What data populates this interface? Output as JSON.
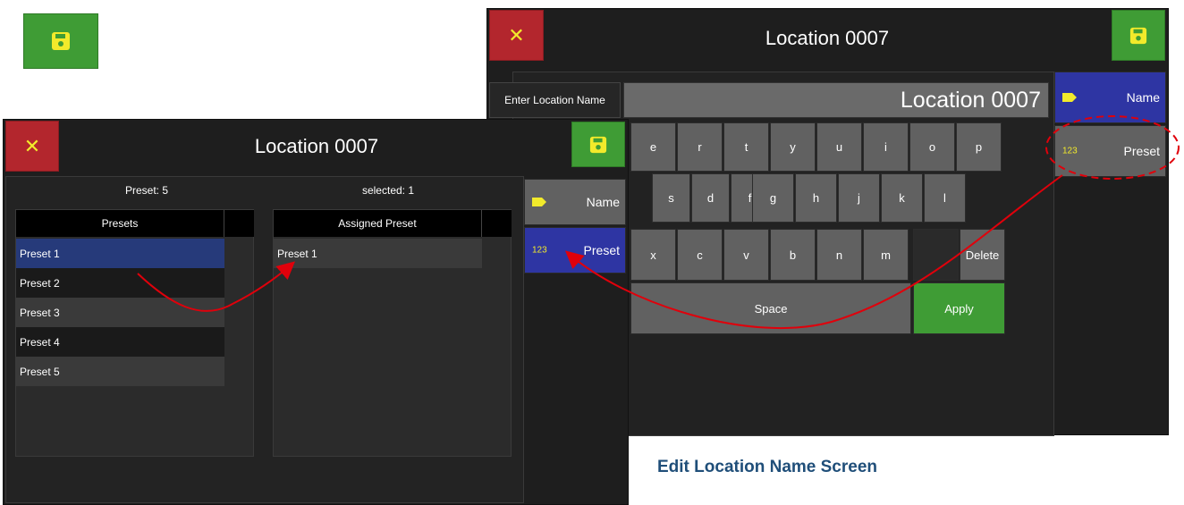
{
  "floating_save": {
    "icon": "save-icon"
  },
  "main_screen": {
    "title": "Location 0007",
    "preset_count_label": "Preset: 5",
    "selected_label": "selected: 1",
    "presets_header": "Presets",
    "assigned_header": "Assigned Preset",
    "presets": [
      "Preset 1",
      "Preset 2",
      "Preset 3",
      "Preset 4",
      "Preset 5"
    ],
    "assigned": [
      "Preset 1"
    ],
    "side_name_label": "Name",
    "side_preset_label": "Preset",
    "side_preset_icon_text": "123"
  },
  "edit_screen": {
    "title": "Location 0007",
    "enter_label": "Enter Location Name",
    "name_value": "Location 0007",
    "row1": [
      "e",
      "r",
      "t",
      "y",
      "u",
      "i",
      "o",
      "p"
    ],
    "row2": [
      "s",
      "d",
      "f",
      "g",
      "h",
      "j",
      "k",
      "l"
    ],
    "row3": [
      "x",
      "c",
      "v",
      "b",
      "n",
      "m"
    ],
    "delete_label": "Delete",
    "space_label": "Space",
    "apply_label": "Apply",
    "side_name_label": "Name",
    "side_preset_label": "Preset",
    "side_preset_icon_text": "123"
  },
  "caption": "Edit Location Name Screen",
  "colors": {
    "green": "#3f9c35",
    "red": "#b3262d",
    "blue": "#2e35a3",
    "dark": "#1e1e1e",
    "key": "#616161",
    "annotation": "#e0000b"
  }
}
